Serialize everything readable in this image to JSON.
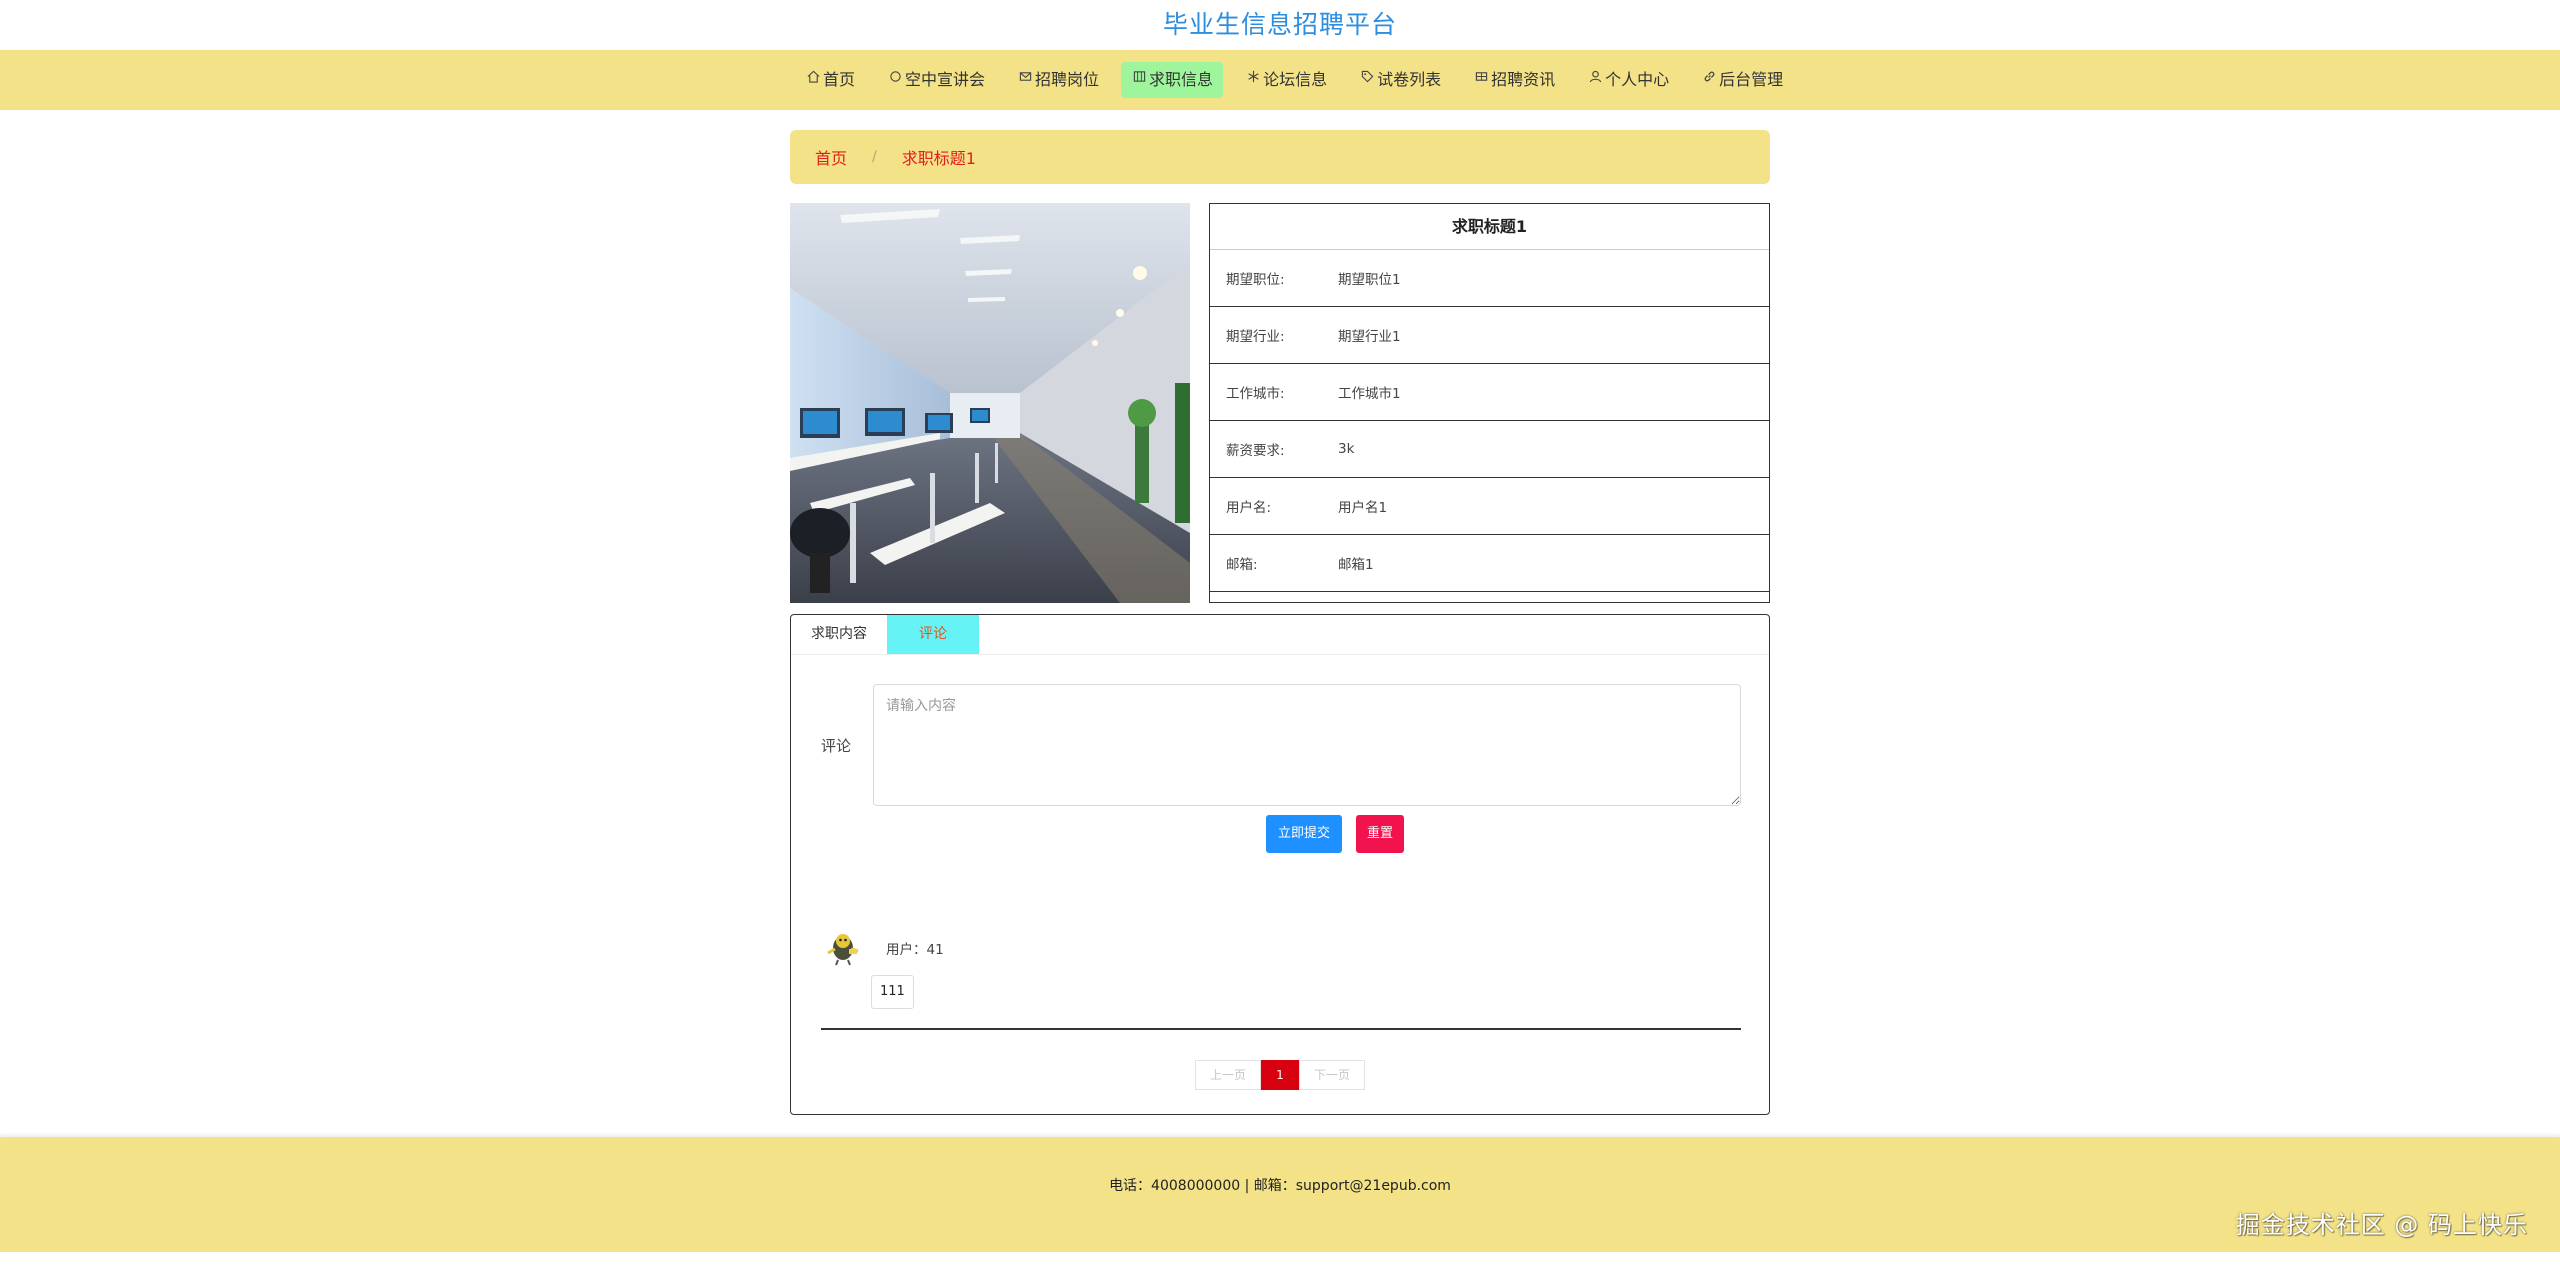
{
  "site": {
    "title": "毕业生信息招聘平台"
  },
  "nav": {
    "items": [
      {
        "label": "首页",
        "icon": "home-icon"
      },
      {
        "label": "空中宣讲会",
        "icon": "circle-icon"
      },
      {
        "label": "招聘岗位",
        "icon": "mail-icon"
      },
      {
        "label": "求职信息",
        "icon": "list-icon",
        "active": true
      },
      {
        "label": "论坛信息",
        "icon": "snowflake-icon"
      },
      {
        "label": "试卷列表",
        "icon": "tag-icon"
      },
      {
        "label": "招聘资讯",
        "icon": "grid-icon"
      },
      {
        "label": "个人中心",
        "icon": "user-icon"
      },
      {
        "label": "后台管理",
        "icon": "link-icon"
      }
    ],
    "active_bg": "#9ff59c"
  },
  "breadcrumb": {
    "home": "首页",
    "separator": "/",
    "current": "求职标题1"
  },
  "detail": {
    "title": "求职标题1",
    "fields": [
      {
        "label": "期望职位:",
        "value": "期望职位1"
      },
      {
        "label": "期望行业:",
        "value": "期望行业1"
      },
      {
        "label": "工作城市:",
        "value": "工作城市1"
      },
      {
        "label": "薪资要求:",
        "value": "3k"
      },
      {
        "label": "用户名:",
        "value": "用户名1"
      },
      {
        "label": "邮箱:",
        "value": "邮箱1"
      }
    ]
  },
  "tabs": [
    {
      "label": "求职内容"
    },
    {
      "label": "评论",
      "active": true
    }
  ],
  "comment_form": {
    "label": "评论",
    "placeholder": "请输入内容",
    "submit_label": "立即提交",
    "reset_label": "重置"
  },
  "comments": [
    {
      "user": "用户：41",
      "content": "111"
    }
  ],
  "pagination": {
    "prev": "上一页",
    "current": "1",
    "next": "下一页"
  },
  "footer": {
    "text": "电话：4008000000 | 邮箱：support@21epub.com"
  },
  "watermark": "掘金技术社区 @ 码上快乐",
  "colors": {
    "theme_yellow": "#f3e287",
    "title_blue": "#2d8ee0",
    "breadcrumb_red": "#e01e1e",
    "submit_blue": "#1e90ff",
    "reset_red": "#f0134d",
    "tab_active": "#66f3f5"
  }
}
